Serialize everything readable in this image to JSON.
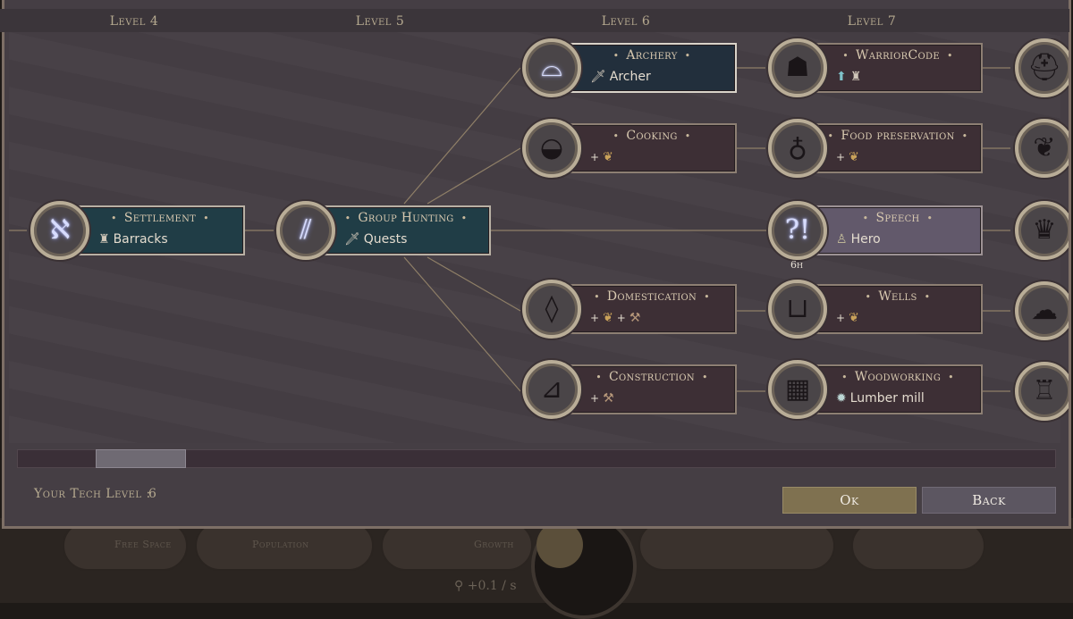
{
  "levels": [
    "Level 4",
    "Level 5",
    "Level 6",
    "Level 7"
  ],
  "nodes": {
    "settlement": {
      "title": "Settlement",
      "reward": "Barracks",
      "icon": "crossed-tools-icon"
    },
    "group_hunting": {
      "title": "Group Hunting",
      "reward": "Quests",
      "icon": "spears-icon"
    },
    "archery": {
      "title": "Archery",
      "reward": "Archer",
      "icon": "bow-icon"
    },
    "cooking": {
      "title": "Cooking",
      "reward": "+",
      "icon": "pot-icon"
    },
    "domestication": {
      "title": "Domestication",
      "reward": "+",
      "reward2": "+",
      "icon": "animal-icon"
    },
    "construction": {
      "title": "Construction",
      "reward": "+",
      "icon": "saw-icon"
    },
    "warrior_code": {
      "title": "WarriorCode",
      "icon": "warrior-head-icon"
    },
    "food_preservation": {
      "title": "Food preservation",
      "reward": "+",
      "icon": "amphora-icon"
    },
    "speech": {
      "title": "Speech",
      "reward": "Hero",
      "icon": "speech-icon",
      "time": "6h"
    },
    "wells": {
      "title": "Wells",
      "reward": "+",
      "icon": "well-icon"
    },
    "woodworking": {
      "title": "Woodworking",
      "reward": "Lumber mill",
      "icon": "woodworking-icon"
    }
  },
  "scrollbar": {
    "position_fraction": 0.08
  },
  "footer": {
    "tech_level_label": "Your Tech Level :",
    "tech_level_value": "6",
    "ok_label": "Ok",
    "back_label": "Back"
  },
  "hud": {
    "free_space_label": "Free Space",
    "population_label": "Population",
    "growth_label": "Growth",
    "rate": "+0.1 / s"
  },
  "colors": {
    "dialog_bg": "#453e44",
    "researched_node": "#203d46",
    "locked_node": "#3d2f35",
    "highlight_node": "#62596b",
    "ok_button": "#7f7150",
    "back_button": "#5c5661"
  }
}
